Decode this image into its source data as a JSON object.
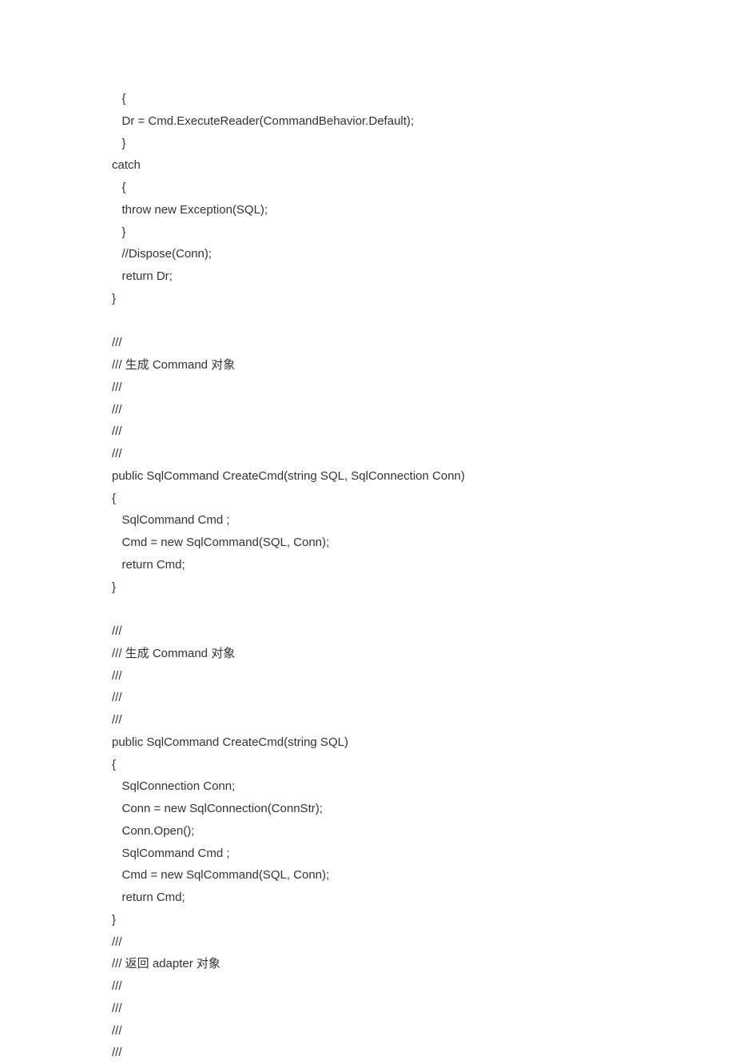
{
  "code": {
    "lines": [
      "   {",
      "   Dr = Cmd.ExecuteReader(CommandBehavior.Default);",
      "   }",
      "catch",
      "   {",
      "   throw new Exception(SQL);",
      "   }",
      "   //Dispose(Conn);",
      "   return Dr;",
      "}",
      "",
      "///",
      "/// 生成 Command 对象",
      "///",
      "///",
      "///",
      "///",
      "public SqlCommand CreateCmd(string SQL, SqlConnection Conn)",
      "{",
      "   SqlCommand Cmd ;",
      "   Cmd = new SqlCommand(SQL, Conn);",
      "   return Cmd;",
      "}",
      "",
      "///",
      "/// 生成 Command 对象",
      "///",
      "///",
      "///",
      "public SqlCommand CreateCmd(string SQL)",
      "{",
      "   SqlConnection Conn;",
      "   Conn = new SqlConnection(ConnStr);",
      "   Conn.Open();",
      "   SqlCommand Cmd ;",
      "   Cmd = new SqlCommand(SQL, Conn);",
      "   return Cmd;",
      "}",
      "///",
      "/// 返回 adapter 对象",
      "///",
      "///",
      "///",
      "///"
    ]
  }
}
